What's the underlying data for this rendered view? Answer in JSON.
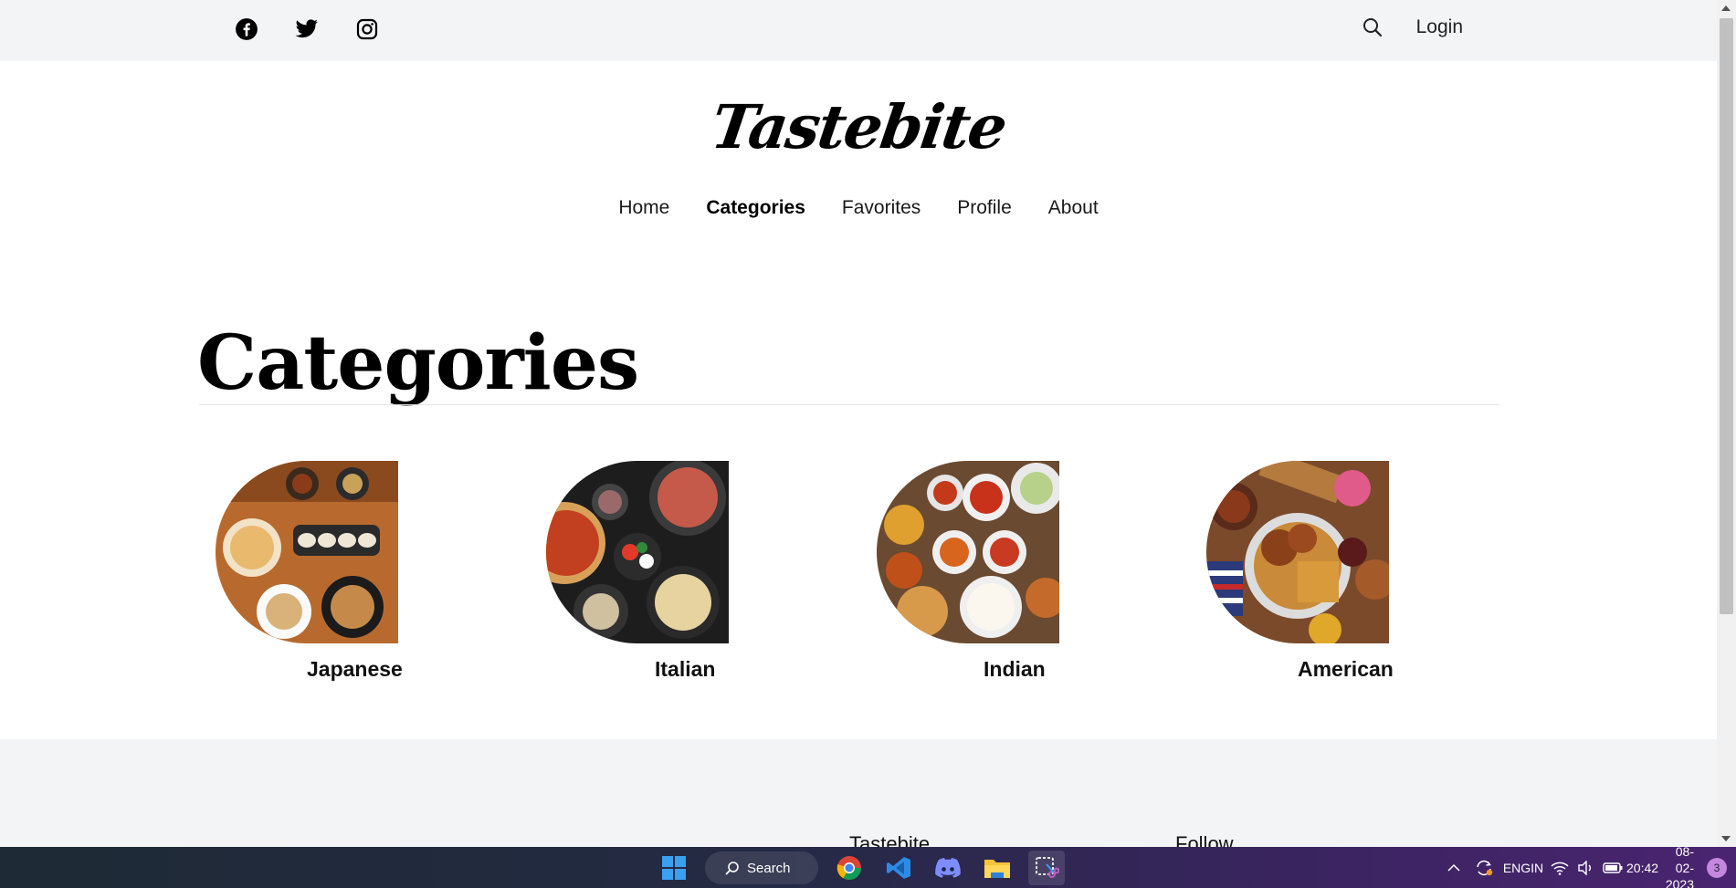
{
  "social": [
    "facebook-icon",
    "twitter-icon",
    "instagram-icon"
  ],
  "header": {
    "login_label": "Login",
    "search_icon": "search-icon"
  },
  "logo": {
    "text": "Tastebite"
  },
  "nav": {
    "items": [
      {
        "label": "Home"
      },
      {
        "label": "Categories",
        "active": true
      },
      {
        "label": "Favorites"
      },
      {
        "label": "Profile"
      },
      {
        "label": "About"
      }
    ]
  },
  "page": {
    "title": "Categories"
  },
  "categories": [
    {
      "label": "Japanese"
    },
    {
      "label": "Italian"
    },
    {
      "label": "Indian"
    },
    {
      "label": "American"
    }
  ],
  "footer": {
    "col1": "Tastebite",
    "col2": "Follow"
  },
  "taskbar": {
    "search_label": "Search",
    "lang_line1": "ENG",
    "lang_line2": "IN",
    "time": "20:42",
    "date": "08-02-2023",
    "notification_count": "3"
  },
  "colors": {
    "topbar": "#f3f4f6",
    "accent": "#000000"
  }
}
